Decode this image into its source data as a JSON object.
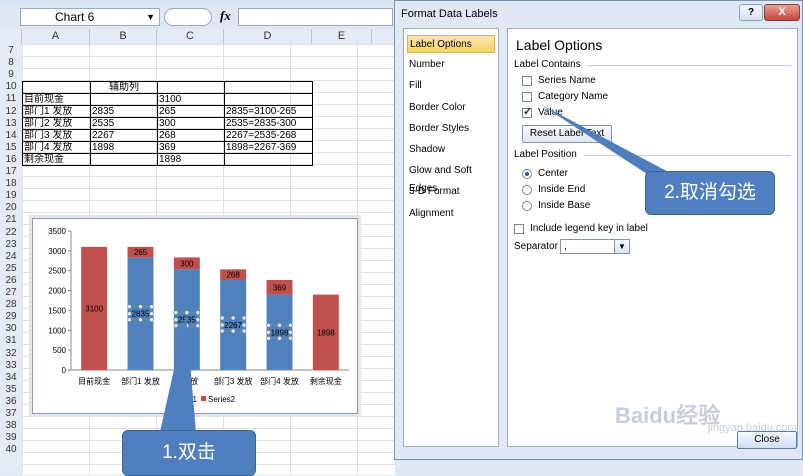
{
  "excel": {
    "name_box": "Chart 6",
    "fx_label": "fx",
    "columns": [
      "A",
      "B",
      "C",
      "D",
      "E"
    ],
    "rows": [
      "7",
      "8",
      "9",
      "10",
      "11",
      "12",
      "13",
      "14",
      "15",
      "16",
      "17",
      "18",
      "19",
      "20",
      "21",
      "22",
      "23",
      "24",
      "25",
      "26",
      "27",
      "28",
      "29",
      "30",
      "31",
      "32",
      "33",
      "34",
      "35",
      "36",
      "37",
      "38",
      "39",
      "40"
    ],
    "table": [
      [
        "",
        "辅助列",
        "",
        ""
      ],
      [
        "目前现金",
        "",
        "3100",
        ""
      ],
      [
        "部门1 发放",
        "2835",
        "265",
        "2835=3100-265"
      ],
      [
        "部门2 发放",
        "2535",
        "300",
        "2535=2835-300"
      ],
      [
        "部门3 发放",
        "2267",
        "268",
        "2267=2535-268"
      ],
      [
        "部门4 发放",
        "1898",
        "369",
        "1898=2267-369"
      ],
      [
        "剩余现金",
        "",
        "1898",
        ""
      ]
    ]
  },
  "chart_data": {
    "type": "bar",
    "stacked": true,
    "categories": [
      "目前现金",
      "部门1 发放",
      "部门2 发放",
      "部门3 发放",
      "部门4 发放",
      "剩余现金"
    ],
    "category_labels_visible": [
      "目前现金",
      "部门1 发放",
      "2 发放",
      "部门3 发放",
      "部门4 发放",
      "剩余现金"
    ],
    "series": [
      {
        "name": "Series1",
        "legend_visible": "ries1",
        "color": "#4f81bd",
        "values": [
          0,
          2835,
          2535,
          2267,
          1898,
          0
        ]
      },
      {
        "name": "Series2",
        "legend_visible": "Series2",
        "color": "#c0504d",
        "values": [
          3100,
          265,
          300,
          268,
          369,
          1898
        ]
      }
    ],
    "data_labels": {
      "series1": [
        "",
        "2835",
        "2535",
        "2267",
        "1898",
        ""
      ],
      "series2": [
        "3100",
        "265",
        "300",
        "268",
        "369",
        "1898"
      ]
    },
    "y_ticks": [
      "0",
      "500",
      "1000",
      "1500",
      "2000",
      "2500",
      "3000",
      "3500"
    ],
    "ylim": [
      0,
      3500
    ],
    "legend_position": "bottom",
    "grid": false
  },
  "dialog": {
    "title": "Format Data Labels",
    "help": "?",
    "close_x": "X",
    "nav": [
      "Label Options",
      "Number",
      "Fill",
      "Border Color",
      "Border Styles",
      "Shadow",
      "Glow and Soft Edges",
      "3-D Format",
      "Alignment"
    ],
    "pane_title": "Label Options",
    "label_contains": "Label Contains",
    "series_name": "Series Name",
    "category_name": "Category Name",
    "value": "Value",
    "reset_button": "Reset Label Text",
    "label_position": "Label Position",
    "center": "Center",
    "inside_end": "Inside End",
    "inside_base": "Inside Base",
    "include_legend": "Include legend key in label",
    "separator_label": "Separator",
    "separator_value": ",",
    "close_button": "Close"
  },
  "callouts": {
    "step1": "1.双击",
    "step2": "2.取消勾选"
  },
  "watermark": {
    "text": "Baidu经验",
    "url": "jingyan.baidu.com"
  }
}
